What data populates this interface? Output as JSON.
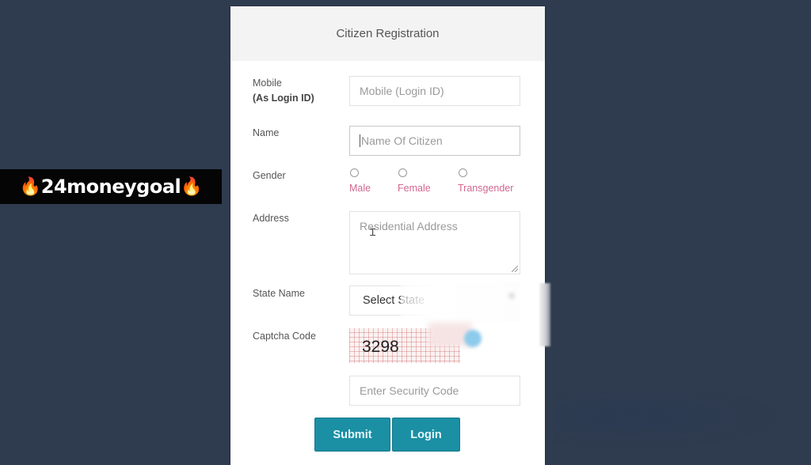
{
  "watermark": {
    "text": "24moneygoal",
    "flame_icon": "🔥"
  },
  "form": {
    "title": "Citizen Registration",
    "mobile": {
      "label": "Mobile",
      "sublabel": "(As Login ID)",
      "placeholder": "Mobile (Login ID)"
    },
    "name": {
      "label": "Name",
      "placeholder": "Name Of Citizen",
      "focused": true
    },
    "gender": {
      "label": "Gender",
      "options": [
        "Male",
        "Female",
        "Transgender"
      ],
      "selected": null
    },
    "address": {
      "label": "Address",
      "placeholder": "Residential Address"
    },
    "state": {
      "label": "State Name",
      "selected": "Select State"
    },
    "captcha": {
      "label": "Captcha Code",
      "code": "3298",
      "placeholder": "Enter Security Code"
    },
    "buttons": {
      "submit": "Submit",
      "login": "Login"
    }
  },
  "colors": {
    "background": "#2f3b4e",
    "button": "#1b8fa4",
    "radio_label": "#d0678f",
    "header_bg": "#f3f3f3"
  }
}
